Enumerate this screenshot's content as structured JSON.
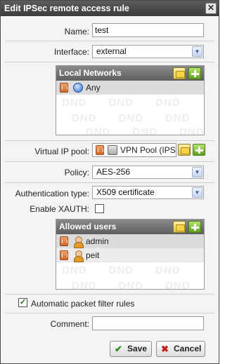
{
  "dialog": {
    "title": "Edit IPSec remote access rule",
    "close_glyph": "✕"
  },
  "form": {
    "name_label": "Name:",
    "name_value": "test",
    "interface_label": "Interface:",
    "interface_value": "external",
    "virtual_ip_label": "Virtual IP pool:",
    "virtual_ip_value": "VPN Pool (IPSec)",
    "policy_label": "Policy:",
    "policy_value": "AES-256",
    "auth_label": "Authentication type:",
    "auth_value": "X509 certificate",
    "xauth_label": "Enable XAUTH:",
    "xauth_checked": false,
    "auto_rules_label": "Automatic packet filter rules",
    "auto_rules_checked": true,
    "comment_label": "Comment:",
    "comment_value": ""
  },
  "local_networks": {
    "title": "Local Networks",
    "items": [
      {
        "label": "Any",
        "icon": "globe-icon"
      }
    ]
  },
  "allowed_users": {
    "title": "Allowed users",
    "items": [
      {
        "label": "admin",
        "icon": "user-icon"
      },
      {
        "label": "peit",
        "icon": "user-icon"
      }
    ]
  },
  "watermark": "DND",
  "buttons": {
    "save": "Save",
    "cancel": "Cancel"
  },
  "colors": {
    "save_check": "#2e8b1e",
    "cancel_x": "#c81e1e"
  }
}
